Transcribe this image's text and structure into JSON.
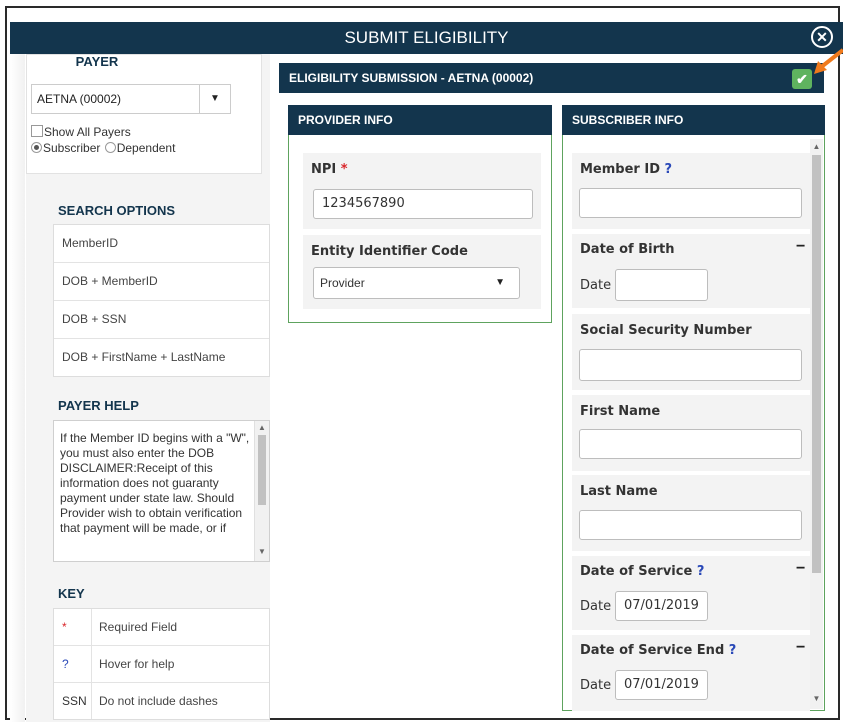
{
  "dialog": {
    "title": "SUBMIT ELIGIBILITY",
    "close_icon": "close-circle-icon"
  },
  "payer": {
    "title": "PAYER",
    "selected": "AETNA (00002)",
    "show_all_label": "Show All Payers",
    "show_all_checked": false,
    "radio_subscriber": "Subscriber",
    "radio_dependent": "Dependent",
    "selected_type": "Subscriber"
  },
  "search_options": {
    "title": "SEARCH OPTIONS",
    "items": [
      "MemberID",
      "DOB + MemberID",
      "DOB + SSN",
      "DOB + FirstName + LastName"
    ]
  },
  "payer_help": {
    "title": "PAYER HELP",
    "text": "If the Member ID begins with a \"W\", you must also enter the DOB\nDISCLAIMER:Receipt of this information does not guaranty payment under state law. Should Provider wish to obtain verification that payment will be made, or if"
  },
  "key": {
    "title": "KEY",
    "rows": [
      {
        "symbol": "*",
        "desc": "Required Field"
      },
      {
        "symbol": "?",
        "desc": "Hover for help"
      },
      {
        "symbol": "SSN",
        "desc": "Do not include dashes"
      }
    ]
  },
  "submission": {
    "header": "ELIGIBILITY SUBMISSION - AETNA (00002)",
    "submit_icon": "checkmark-icon"
  },
  "provider": {
    "header": "PROVIDER INFO",
    "npi_label": "NPI",
    "npi_required": "*",
    "npi_value": "1234567890",
    "entity_label": "Entity Identifier Code",
    "entity_value": "Provider"
  },
  "subscriber": {
    "header": "SUBSCRIBER INFO",
    "member_id_label": "Member ID",
    "help_mark": "?",
    "member_id_value": "",
    "dob_label": "Date of Birth",
    "date_word": "Date",
    "dob_value": "",
    "collapse_symbol": "−",
    "ssn_label": "Social Security Number",
    "ssn_value": "",
    "first_name_label": "First Name",
    "first_name_value": "",
    "last_name_label": "Last Name",
    "last_name_value": "",
    "dos_label": "Date of Service",
    "dos_value": "07/01/2019",
    "dos_end_label": "Date of Service End",
    "dos_end_value": "07/01/2019"
  },
  "colors": {
    "header_bg": "#13354d",
    "panel_border": "#5ea35e",
    "submit_green": "#5fb35f",
    "arrow_orange": "#f07a1c",
    "required_red": "#d9262b",
    "help_blue": "#2a49b8"
  }
}
